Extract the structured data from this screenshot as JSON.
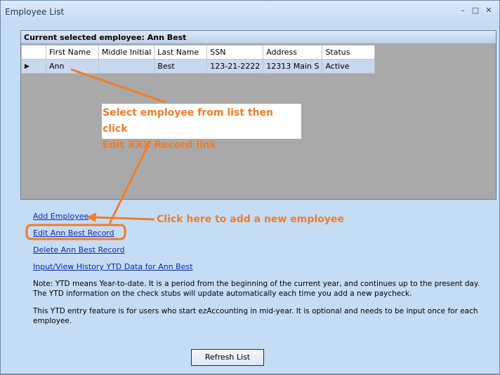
{
  "window": {
    "title": "Employee List",
    "controls": [
      "minimize",
      "maximize",
      "close"
    ]
  },
  "grid": {
    "caption": "Current selected employee:  Ann Best",
    "columns": [
      "First Name",
      "Middle Initial",
      "Last Name",
      "SSN",
      "Address",
      "Status"
    ],
    "rows": [
      {
        "first_name": "Ann",
        "middle_initial": "",
        "last_name": "Best",
        "ssn": "123-21-2222",
        "address": "12313 Main S",
        "status": "Active"
      }
    ],
    "current_row_marker": "▶"
  },
  "links": {
    "add": "Add Employee",
    "edit": "Edit Ann Best Record",
    "delete": "Delete Ann Best Record",
    "ytd": "Input/View History YTD Data for Ann Best"
  },
  "notes": {
    "ytd_note": "Note: YTD means Year-to-date. It is a period from the beginning of the current year, and continues up to the present day. The YTD information on the check stubs will update automatically each time you add a new paycheck.",
    "feature_note": "This YTD entry feature is for users who start ezAccounting in mid-year. It is optional and needs to be input once for each employee."
  },
  "buttons": {
    "refresh": "Refresh List"
  },
  "annotations": {
    "select_line1": "Select employee from list then click",
    "select_line2": "Edit XXX Record link",
    "add_hint": "Click here to add a new employee",
    "accent_color": "#f07d28"
  }
}
